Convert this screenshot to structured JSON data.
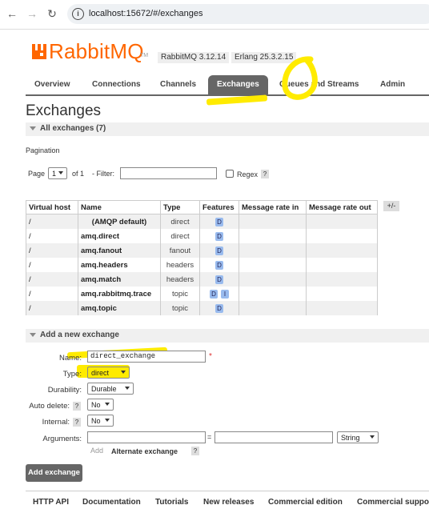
{
  "browser": {
    "url": "localhost:15672/#/exchanges"
  },
  "header": {
    "logo_text": "RabbitMQ",
    "logo_tm": "TM",
    "rabbitmq_version": "RabbitMQ 3.12.14",
    "erlang_version": "Erlang 25.3.2.15"
  },
  "tabs": {
    "overview": "Overview",
    "connections": "Connections",
    "channels": "Channels",
    "exchanges": "Exchanges",
    "queues": "Queues and Streams",
    "admin": "Admin"
  },
  "page_title": "Exchanges",
  "all_exchanges": {
    "label": "All exchanges (7)"
  },
  "pagination": {
    "label": "Pagination",
    "page_label": "Page",
    "page_value": "1",
    "of_label": "of 1",
    "filter_label": "- Filter:",
    "filter_value": "",
    "regex_label": "Regex",
    "help": "?"
  },
  "table": {
    "headers": [
      "Virtual host",
      "Name",
      "Type",
      "Features",
      "Message rate in",
      "Message rate out"
    ],
    "plusminus": "+/-",
    "rows": [
      {
        "vhost": "/",
        "name": "(AMQP default)",
        "type": "direct",
        "features": [
          "D"
        ]
      },
      {
        "vhost": "/",
        "name": "amq.direct",
        "type": "direct",
        "features": [
          "D"
        ]
      },
      {
        "vhost": "/",
        "name": "amq.fanout",
        "type": "fanout",
        "features": [
          "D"
        ]
      },
      {
        "vhost": "/",
        "name": "amq.headers",
        "type": "headers",
        "features": [
          "D"
        ]
      },
      {
        "vhost": "/",
        "name": "amq.match",
        "type": "headers",
        "features": [
          "D"
        ]
      },
      {
        "vhost": "/",
        "name": "amq.rabbitmq.trace",
        "type": "topic",
        "features": [
          "D",
          "I"
        ]
      },
      {
        "vhost": "/",
        "name": "amq.topic",
        "type": "topic",
        "features": [
          "D"
        ]
      }
    ]
  },
  "add_exchange": {
    "section_label": "Add a new exchange",
    "name_label": "Name:",
    "name_value": "direct_exchange",
    "required_mark": "*",
    "type_label": "Type:",
    "type_value": "direct",
    "durability_label": "Durability:",
    "durability_value": "Durable",
    "auto_delete_label": "Auto delete:",
    "auto_delete_value": "No",
    "internal_label": "Internal:",
    "internal_value": "No",
    "arguments_label": "Arguments:",
    "equals": "=",
    "arg_type_value": "String",
    "add_link": "Add",
    "alternate_exchange": "Alternate exchange",
    "help": "?",
    "submit_button": "Add exchange"
  },
  "footer": {
    "links": [
      "HTTP API",
      "Documentation",
      "Tutorials",
      "New releases",
      "Commercial edition",
      "Commercial suppor"
    ]
  },
  "colors": {
    "brand": "#ff6600",
    "highlight": "#ffeb00",
    "tab_active": "#666666"
  }
}
